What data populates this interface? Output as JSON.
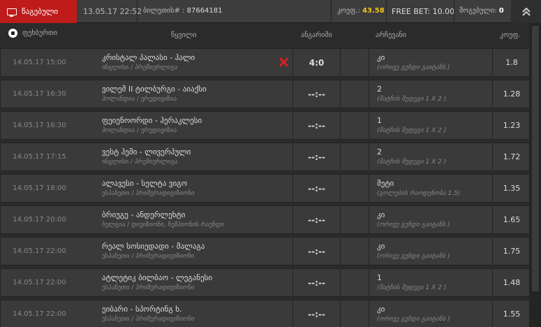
{
  "topbar": {
    "tab_label": "წაგებული",
    "datetime": "13.05.17 22:52",
    "ticket_label": "ბილეთის# :",
    "ticket_number": "87664181",
    "coef_label": "კოეფ.:",
    "coef_value": "43.58",
    "freebet_label": "FREE BET:",
    "freebet_value": "10.00",
    "win_label": "მოგებული:",
    "win_value": "0"
  },
  "header": {
    "sport": "ფეხბურთი",
    "event": "წყვილი",
    "score": "ანგარიში",
    "choice": "არჩევანი",
    "odds": "კოეფ."
  },
  "rows": [
    {
      "date": "14.05.17 15:00",
      "name": "კრისტალ პალასი - ჰალი",
      "league": "ინგლისი / პრემიერლიგა",
      "score": "4:0",
      "lost": true,
      "pick": "კი",
      "market": "(ორივე გუნდი გაიტანს )",
      "odds": "1.8"
    },
    {
      "date": "14.05.17 16:30",
      "name": "ვილემ II ტილბურგი - აიაქსი",
      "league": "ჰოლანდია / ერედივიზია",
      "score": "--:--",
      "lost": false,
      "pick": "2",
      "market": "(მატჩის შედეგი 1 X 2 )",
      "odds": "1.28"
    },
    {
      "date": "14.05.17 16:30",
      "name": "ფეიენოორდი - ჰერაკლესი",
      "league": "ჰოლანდია / ერედივიზია",
      "score": "--:--",
      "lost": false,
      "pick": "1",
      "market": "(მატჩის შედეგი 1 X 2 )",
      "odds": "1.23"
    },
    {
      "date": "14.05.17 17:15",
      "name": "ვესტ ჰემი - ლივერპული",
      "league": "ინგლისი / პრემიერლიგა",
      "score": "--:--",
      "lost": false,
      "pick": "2",
      "market": "(მატჩის შედეგი 1 X 2 )",
      "odds": "1.72"
    },
    {
      "date": "14.05.17 18:00",
      "name": "ალავესი - სელტა ვიგო",
      "league": "ესპანეთი / პრიმერადივიზიონი",
      "score": "--:--",
      "lost": false,
      "pick": "მეტი",
      "market": "(გოლების რაოდენობა 1.5)",
      "odds": "1.35"
    },
    {
      "date": "14.05.17 20:00",
      "name": "ბრიუგე - ანდერლეხტი",
      "league": "ბელგია / დივიზიონი, ჩემპიონის რაუნდი",
      "score": "--:--",
      "lost": false,
      "pick": "კი",
      "market": "(ორივე გუნდი გაიტანს )",
      "odds": "1.65"
    },
    {
      "date": "14.05.17 22:00",
      "name": "რეალ სოსიედადი - მალაგა",
      "league": "ესპანეთი / პრიმერადივიზიონი",
      "score": "--:--",
      "lost": false,
      "pick": "კი",
      "market": "(ორივე გუნდი გაიტანს )",
      "odds": "1.75"
    },
    {
      "date": "14.05.17 22:00",
      "name": "ატლეტიკ ბილბაო - ლეგანესი",
      "league": "ესპანეთი / პრიმერადივიზიონი",
      "score": "--:--",
      "lost": false,
      "pick": "1",
      "market": "(მატჩის შედეგი 1 X 2 )",
      "odds": "1.48"
    },
    {
      "date": "14.05.17 22:00",
      "name": "ეიბარი - სპორტინგ ხ.",
      "league": "ესპანეთი / პრიმერადივიზიონი",
      "score": "--:--",
      "lost": false,
      "pick": "კი",
      "market": "(ორივე გუნდი გაიტანს )",
      "odds": "1.55"
    }
  ]
}
